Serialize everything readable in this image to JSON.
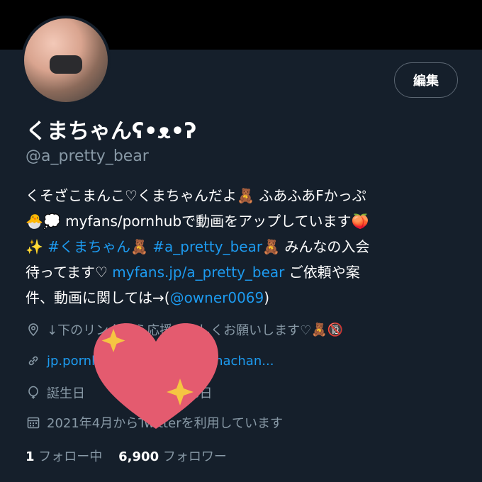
{
  "profile": {
    "name": "くまちゃんʕ•ᴥ•ʔ",
    "handle": "@a_pretty_bear",
    "edit_button": "編集",
    "bio": {
      "l1a": "くそざこまんこ♡くまちゃんだよ",
      "l1b": "ふあふあFかっぷ",
      "l2": "myfans/pornhubで動画をアップしています",
      "tag1": "#くまちゃん",
      "tag2": "#a_pretty_bear",
      "l3c": "みんなの入会",
      "l4a": "待ってます♡",
      "l4link": "myfans.jp/a_pretty_bear",
      "l4b": "ご依頼や案",
      "l5a": "件、動画に関しては→(",
      "l5link": "@owner0069",
      "l5b": ")",
      "emoji_bear": "🧸",
      "emoji_chick": "🐣",
      "emoji_bubble": "💭",
      "emoji_peach": "🍑",
      "emoji_sparkle": "✨"
    },
    "location": "↓下のリンクから応援よろしくお願いします♡",
    "location_emoji_bear": "🧸",
    "location_emoji_18": "🔞",
    "url_text": "jp.pornhub.com/model/kumachan...",
    "birthday_label": "誕生日",
    "birthday_value": "8日",
    "joined_text": "2021年4月からTwitterを利用しています",
    "following_count": "1",
    "following_label": "フォロー中",
    "followers_count": "6,900",
    "followers_label": "フォロワー"
  },
  "icons": {
    "location": "map-pin-icon",
    "link": "link-icon",
    "birthday": "balloon-icon",
    "calendar": "calendar-icon"
  },
  "colors": {
    "background": "#151f2b",
    "link": "#1d9bf0",
    "muted": "#8899a6",
    "heart": "#e45b6f",
    "sparkle": "#f5c542"
  }
}
